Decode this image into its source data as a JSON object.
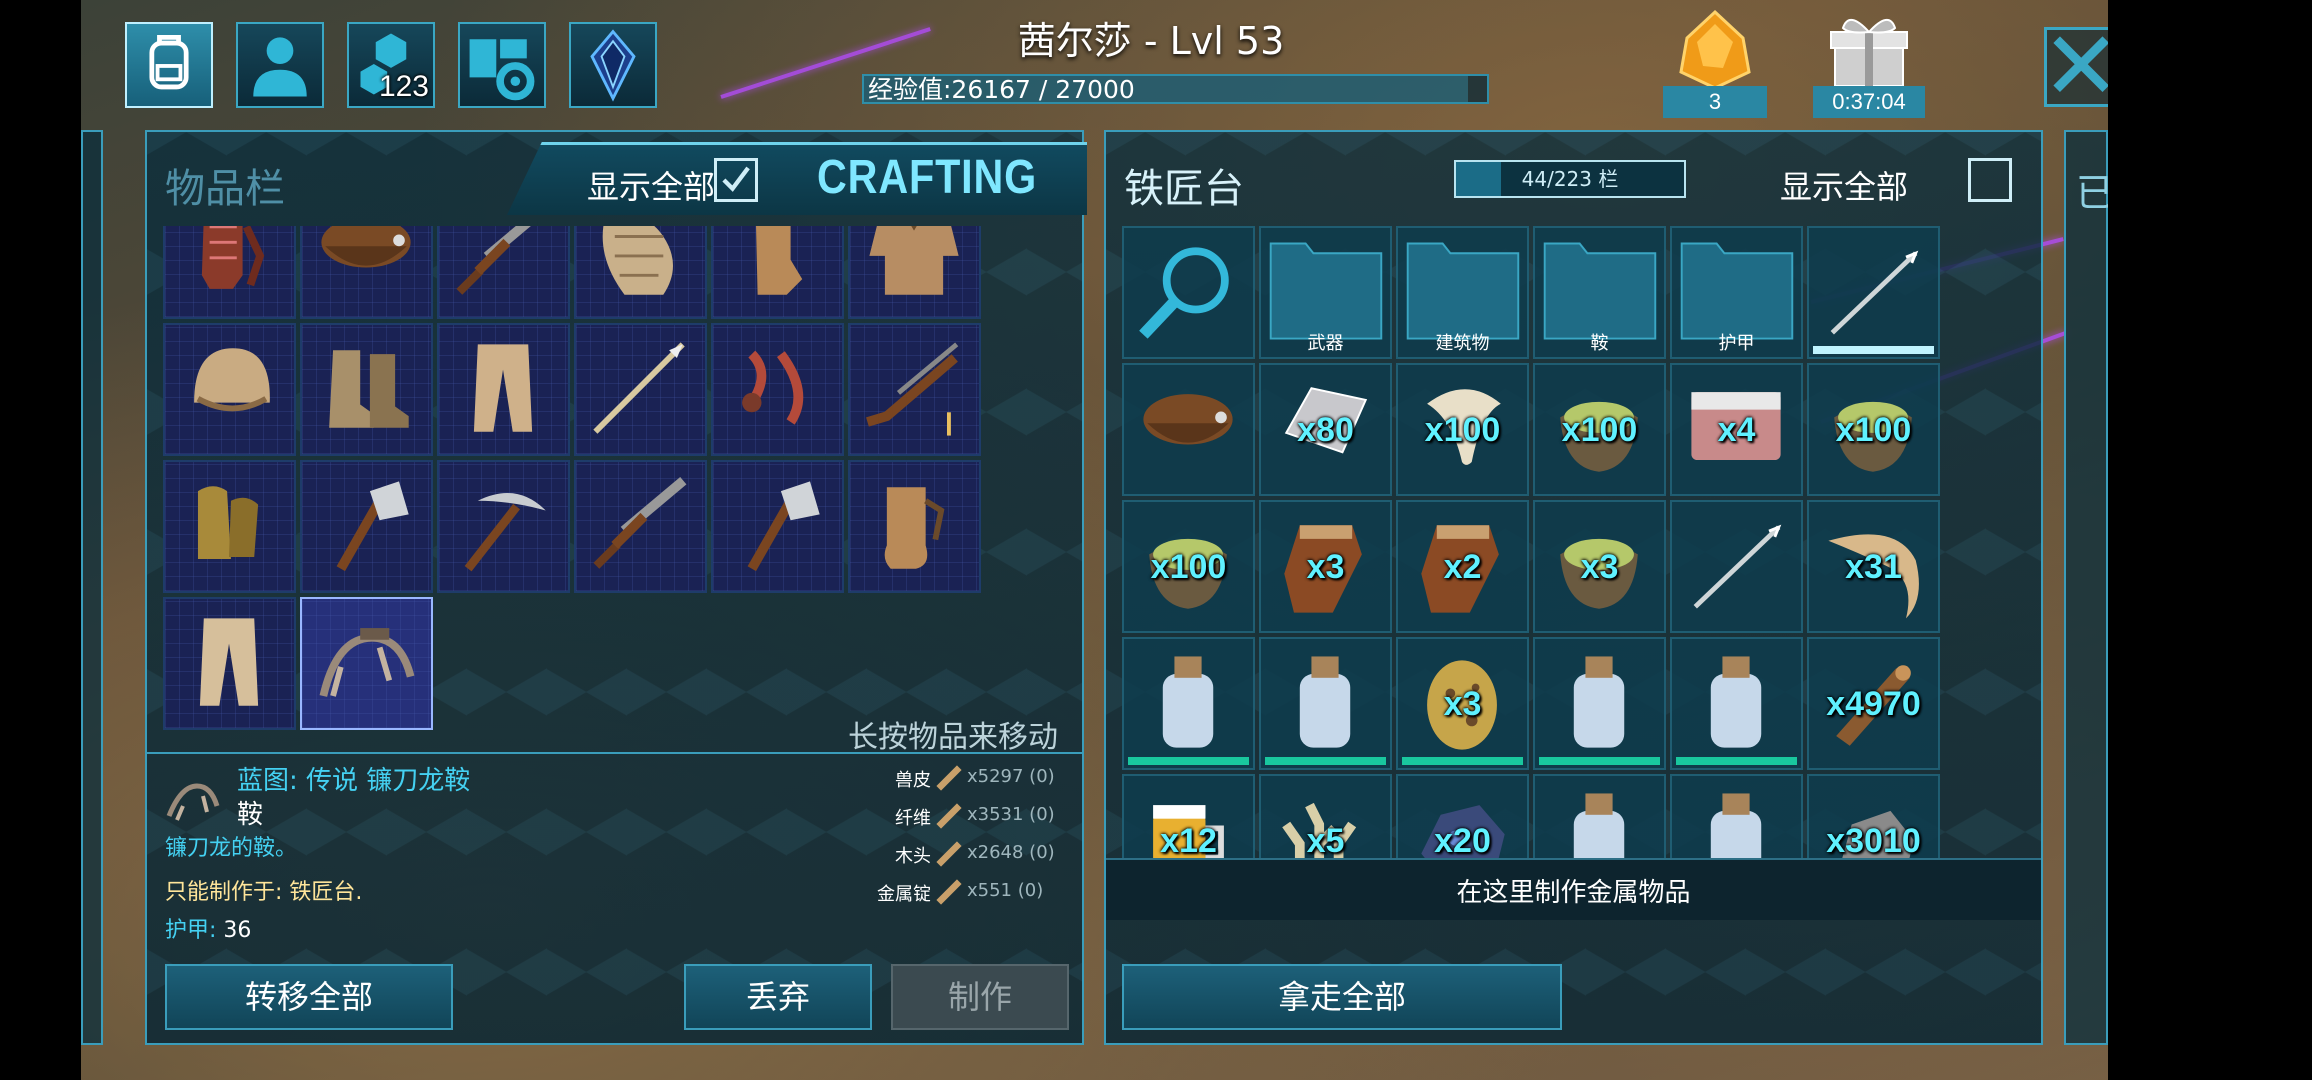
{
  "header": {
    "player_name": "茜尔莎 - Lvl 53",
    "xp_text": "经验值:26167 / 27000",
    "xp_progress": 0.969,
    "engram_points": "123",
    "currency_amount": "3",
    "timer": "0:37:04"
  },
  "inventory": {
    "title": "物品栏",
    "show_all_label": "显示全部",
    "show_all_checked": true,
    "crafting_label": "CRAFTING",
    "hint": "长按物品来移动",
    "items": [
      {
        "icon": "gloves-icon"
      },
      {
        "icon": "saddle-icon"
      },
      {
        "icon": "shotgun-icon"
      },
      {
        "icon": "cloth-sleeve-icon"
      },
      {
        "icon": "leather-gloves-icon"
      },
      {
        "icon": "hide-shirt-icon"
      },
      {
        "icon": "cloth-hat-icon"
      },
      {
        "icon": "boots-icon"
      },
      {
        "icon": "cloth-pants-icon"
      },
      {
        "icon": "spear-icon"
      },
      {
        "icon": "bola-icon"
      },
      {
        "icon": "rifle-icon"
      },
      {
        "icon": "ghillie-gloves-icon"
      },
      {
        "icon": "hatchet-icon"
      },
      {
        "icon": "pickaxe-icon"
      },
      {
        "icon": "shotgun-icon"
      },
      {
        "icon": "hatchet-icon"
      },
      {
        "icon": "hide-gloves-icon"
      },
      {
        "icon": "hide-pants-icon"
      },
      {
        "icon": "saddle-blueprint-icon"
      }
    ],
    "selected_index": 19,
    "detail": {
      "name": "蓝图: 传说 镰刀龙鞍",
      "type": "鞍",
      "description": "镰刀龙的鞍。",
      "craft_at": "只能制作于: 铁匠台.",
      "armor_label": "护甲:",
      "armor_value": "36"
    },
    "requirements": [
      {
        "name": "兽皮",
        "amount": "x5297 (0)"
      },
      {
        "name": "纤维",
        "amount": "x3531 (0)"
      },
      {
        "name": "木头",
        "amount": "x2648 (0)"
      },
      {
        "name": "金属锭",
        "amount": "x551 (0)"
      }
    ],
    "buttons": {
      "transfer_all": "转移全部",
      "drop": "丢弃",
      "craft": "制作"
    }
  },
  "smithy": {
    "title": "铁匠台",
    "capacity": "44/223 栏",
    "capacity_fraction": 0.197,
    "show_all_label": "显示全部",
    "show_all_checked": false,
    "folders": [
      "武器",
      "建筑物",
      "鞍",
      "护甲"
    ],
    "items": [
      {
        "icon": "search-icon",
        "qty": ""
      },
      {
        "icon": "folder-icon",
        "qty": "",
        "label_index": 0
      },
      {
        "icon": "folder-icon",
        "qty": "",
        "label_index": 1
      },
      {
        "icon": "folder-icon",
        "qty": "",
        "label_index": 2
      },
      {
        "icon": "folder-icon",
        "qty": "",
        "label_index": 3
      },
      {
        "icon": "harpoon-icon",
        "qty": ""
      },
      {
        "icon": "saddle-icon",
        "qty": ""
      },
      {
        "icon": "metal-ingot-icon",
        "qty": "x80"
      },
      {
        "icon": "tooth-icon",
        "qty": "x100"
      },
      {
        "icon": "kibble-icon",
        "qty": "x100"
      },
      {
        "icon": "meat-icon",
        "qty": "x4"
      },
      {
        "icon": "kibble-icon",
        "qty": "x100"
      },
      {
        "icon": "kibble-icon",
        "qty": "x100"
      },
      {
        "icon": "hide-icon",
        "qty": "x3"
      },
      {
        "icon": "hide-icon",
        "qty": "x2"
      },
      {
        "icon": "kibble-icon",
        "qty": "x3"
      },
      {
        "icon": "harpoon-icon",
        "qty": ""
      },
      {
        "icon": "horn-icon",
        "qty": "x31"
      },
      {
        "icon": "bottle-icon",
        "qty": ""
      },
      {
        "icon": "bottle-icon",
        "qty": ""
      },
      {
        "icon": "egg-icon",
        "qty": "x3"
      },
      {
        "icon": "bottle-icon",
        "qty": ""
      },
      {
        "icon": "bottle-icon",
        "qty": ""
      },
      {
        "icon": "wood-icon",
        "qty": "x4970"
      },
      {
        "icon": "beer-icon",
        "qty": "x12"
      },
      {
        "icon": "coral-icon",
        "qty": "x5"
      },
      {
        "icon": "ore-icon",
        "qty": "x20"
      },
      {
        "icon": "bottle-icon",
        "qty": ""
      },
      {
        "icon": "bottle-icon",
        "qty": ""
      },
      {
        "icon": "stone-icon",
        "qty": "x3010"
      }
    ],
    "status_text": "在这里制作金属物品",
    "take_all": "拿走全部"
  },
  "right_stub_char": "已"
}
